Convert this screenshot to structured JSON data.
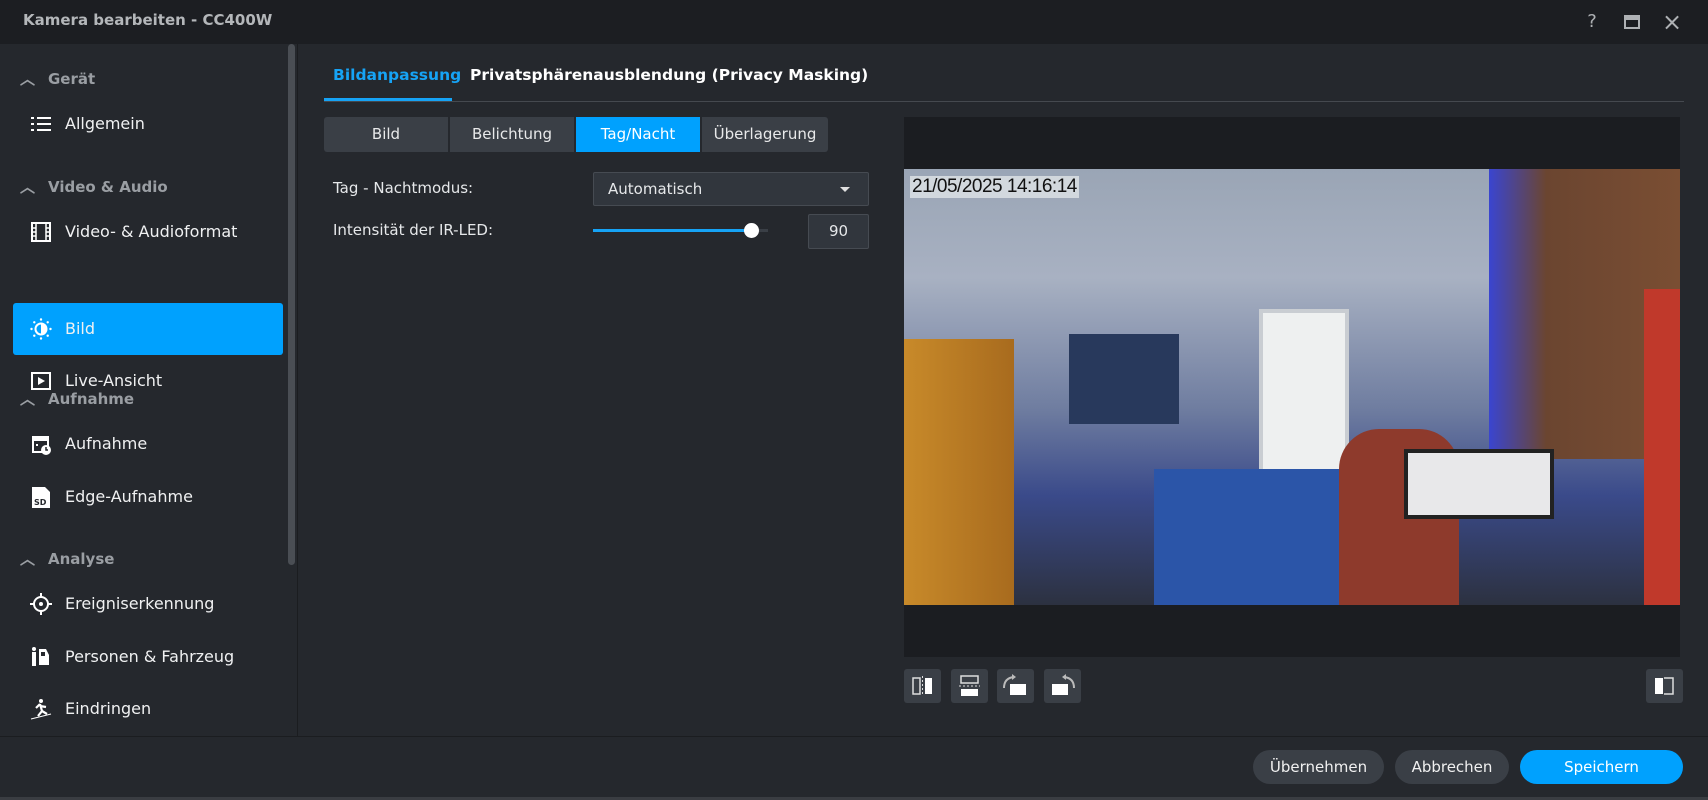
{
  "window": {
    "title": "Kamera bearbeiten - CC400W",
    "help_icon": "?",
    "maximize_icon": "maximize-icon",
    "close_icon": "×"
  },
  "sidebar": {
    "sections": [
      {
        "label": "Gerät",
        "items": [
          {
            "label": "Allgemein",
            "icon": "list-icon"
          }
        ]
      },
      {
        "label": "Video & Audio",
        "items": [
          {
            "label": "Video- & Audioformat",
            "icon": "film-icon"
          },
          {
            "label": "Bild",
            "icon": "brightness-icon",
            "active": true
          },
          {
            "label": "Live-Ansicht",
            "icon": "play-icon"
          }
        ]
      },
      {
        "label": "Aufnahme",
        "items": [
          {
            "label": "Aufnahme",
            "icon": "calendar-clock-icon"
          },
          {
            "label": "Edge-Aufnahme",
            "icon": "sd-card-icon"
          }
        ]
      },
      {
        "label": "Analyse",
        "items": [
          {
            "label": "Ereigniserkennung",
            "icon": "crosshair-icon"
          },
          {
            "label": "Personen & Fahrzeug",
            "icon": "person-vehicle-icon"
          },
          {
            "label": "Eindringen",
            "icon": "intrusion-icon"
          }
        ]
      }
    ]
  },
  "tabs": [
    {
      "label": "Bildanpassung",
      "active": true
    },
    {
      "label": "Privatsphärenausblendung (Privacy Masking)"
    }
  ],
  "subtabs": [
    {
      "label": "Bild"
    },
    {
      "label": "Belichtung"
    },
    {
      "label": "Tag/Nacht",
      "active": true
    },
    {
      "label": "Überlagerung"
    }
  ],
  "form": {
    "mode_label": "Tag - Nachtmodus:",
    "mode_value": "Automatisch",
    "ir_label": "Intensität der IR-LED:",
    "ir_value": "90",
    "ir_percent": 90
  },
  "preview": {
    "timestamp": "21/05/2025 14:16:14"
  },
  "footer": {
    "apply": "Übernehmen",
    "cancel": "Abbrechen",
    "save": "Speichern"
  },
  "colors": {
    "accent": "#00a1fe",
    "background": "#25282d"
  }
}
